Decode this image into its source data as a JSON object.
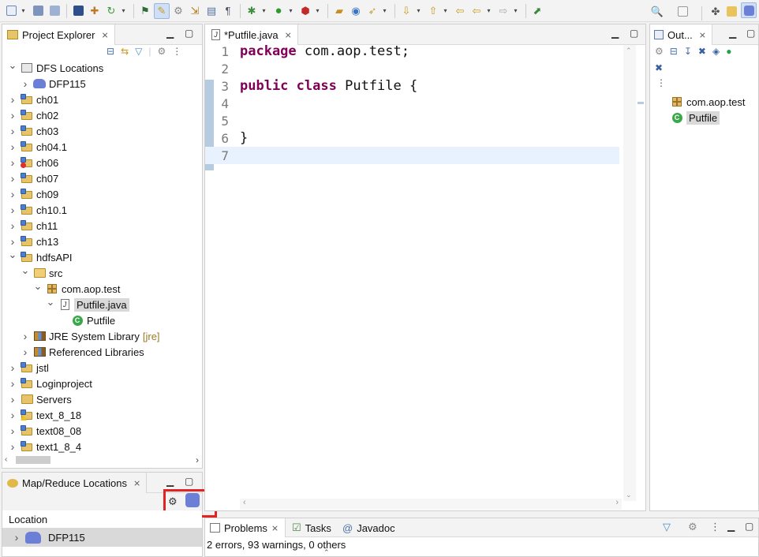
{
  "toolbar": {
    "icons": [
      "new-icon",
      "save-icon",
      "save-all-icon",
      "terminal-icon",
      "new-class-icon",
      "refresh-icon",
      "toggle-breadcrumb-icon",
      "mark-occurrences-icon",
      "block-select-icon",
      "next-annotation-icon",
      "prev-annotation-icon",
      "show-whitespace-icon",
      "debug-icon",
      "run-icon",
      "run-external-icon",
      "open-type-icon",
      "open-task-icon",
      "search-icon",
      "next-edit-icon",
      "prev-edit-icon",
      "back-icon",
      "forward-icon",
      "pin-editor-icon"
    ],
    "right_icons": [
      "quick-access-search-icon",
      "open-perspective-icon",
      "java-ee-perspective-icon",
      "mapreduce-perspective-icon"
    ]
  },
  "project_explorer": {
    "tab_label": "Project Explorer",
    "tree": [
      {
        "label": "DFS Locations",
        "depth": 0,
        "expanded": true,
        "icon": "dfs"
      },
      {
        "label": "DFP115",
        "depth": 1,
        "expanded": false,
        "icon": "elephant"
      },
      {
        "label": "ch01",
        "depth": 0,
        "expanded": false,
        "icon": "proj"
      },
      {
        "label": "ch02",
        "depth": 0,
        "expanded": false,
        "icon": "proj"
      },
      {
        "label": "ch03",
        "depth": 0,
        "expanded": false,
        "icon": "proj"
      },
      {
        "label": "ch04.1",
        "depth": 0,
        "expanded": false,
        "icon": "proj"
      },
      {
        "label": "ch06",
        "depth": 0,
        "expanded": false,
        "icon": "proj-err"
      },
      {
        "label": "ch07",
        "depth": 0,
        "expanded": false,
        "icon": "proj"
      },
      {
        "label": "ch09",
        "depth": 0,
        "expanded": false,
        "icon": "proj"
      },
      {
        "label": "ch10.1",
        "depth": 0,
        "expanded": false,
        "icon": "proj"
      },
      {
        "label": "ch11",
        "depth": 0,
        "expanded": false,
        "icon": "proj"
      },
      {
        "label": "ch13",
        "depth": 0,
        "expanded": false,
        "icon": "proj"
      },
      {
        "label": "hdfsAPI",
        "depth": 0,
        "expanded": true,
        "icon": "proj"
      },
      {
        "label": "src",
        "depth": 1,
        "expanded": true,
        "icon": "src"
      },
      {
        "label": "com.aop.test",
        "depth": 2,
        "expanded": true,
        "icon": "pkg"
      },
      {
        "label": "Putfile.java",
        "depth": 3,
        "expanded": true,
        "icon": "java",
        "selected": true
      },
      {
        "label": "Putfile",
        "depth": 4,
        "expanded": null,
        "icon": "class"
      },
      {
        "label": "JRE System Library",
        "depth": 1,
        "expanded": false,
        "icon": "lib",
        "deco": "[jre]"
      },
      {
        "label": "Referenced Libraries",
        "depth": 1,
        "expanded": false,
        "icon": "lib"
      },
      {
        "label": "jstl",
        "depth": 0,
        "expanded": false,
        "icon": "proj"
      },
      {
        "label": "Loginproject",
        "depth": 0,
        "expanded": false,
        "icon": "proj"
      },
      {
        "label": "Servers",
        "depth": 0,
        "expanded": false,
        "icon": "folder"
      },
      {
        "label": "text_8_18",
        "depth": 0,
        "expanded": false,
        "icon": "proj-warn"
      },
      {
        "label": "text08_08",
        "depth": 0,
        "expanded": false,
        "icon": "proj"
      },
      {
        "label": "text1_8_4",
        "depth": 0,
        "expanded": false,
        "icon": "proj"
      }
    ]
  },
  "mapreduce": {
    "tab_label": "Map/Reduce Locations",
    "column_header": "Location",
    "rows": [
      "DFP115"
    ]
  },
  "editor": {
    "tab_label": "*Putfile.java",
    "lines": [
      {
        "n": "1",
        "parts": [
          {
            "t": "package",
            "kw": true
          },
          {
            "t": " com.aop.test;"
          }
        ]
      },
      {
        "n": "2",
        "parts": []
      },
      {
        "n": "3",
        "parts": [
          {
            "t": "public",
            "kw": true
          },
          {
            "t": " "
          },
          {
            "t": "class",
            "kw": true
          },
          {
            "t": " Putfile {"
          }
        ]
      },
      {
        "n": "4",
        "parts": []
      },
      {
        "n": "5",
        "parts": []
      },
      {
        "n": "6",
        "parts": [
          {
            "t": "}"
          }
        ]
      },
      {
        "n": "7",
        "parts": []
      }
    ],
    "current_line": 7
  },
  "outline": {
    "tab_label": "Out...",
    "items": [
      {
        "label": "com.aop.test",
        "icon": "pkg"
      },
      {
        "label": "Putfile",
        "icon": "class",
        "selected": true
      }
    ]
  },
  "bottom": {
    "tabs": [
      "Problems",
      "Tasks",
      "Javadoc"
    ],
    "status": "2 errors, 93 warnings, 0 others"
  },
  "colors": {
    "keyword": "#7f0055",
    "highlight_box": "#e32222"
  }
}
